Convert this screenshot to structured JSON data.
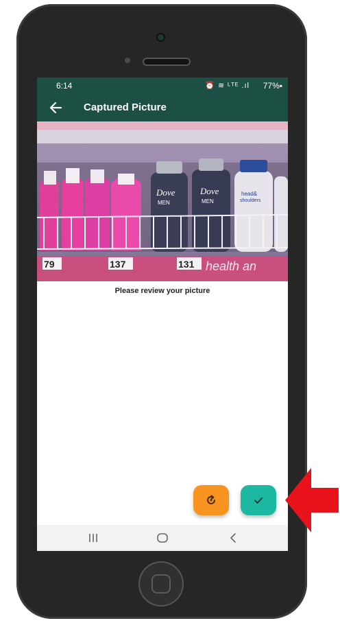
{
  "status_bar": {
    "time": "6:14",
    "icons": "⏰ ≋ ᴸᵀᴱ .ıl",
    "battery": "77%▪"
  },
  "app_bar": {
    "title": "Captured Picture",
    "back_icon": "arrow-left-icon",
    "background": "#1d5045"
  },
  "photo": {
    "price_tags": [
      "79",
      "137",
      "131"
    ],
    "store_banner": "health an",
    "brand_labels": [
      "Dove",
      "MEN",
      "Dove",
      "MEN",
      "head&",
      "shoulders"
    ]
  },
  "caption": "Please review your picture",
  "actions": {
    "retake_icon": "retake-rotate-icon",
    "retake_color": "#f7931e",
    "confirm_icon": "check-icon",
    "confirm_color": "#1db8a2"
  },
  "nav_bar": {
    "items": [
      "recent-apps-icon",
      "home-icon",
      "back-chevron-icon"
    ]
  },
  "annotation": {
    "arrow_color": "#e8121b"
  }
}
